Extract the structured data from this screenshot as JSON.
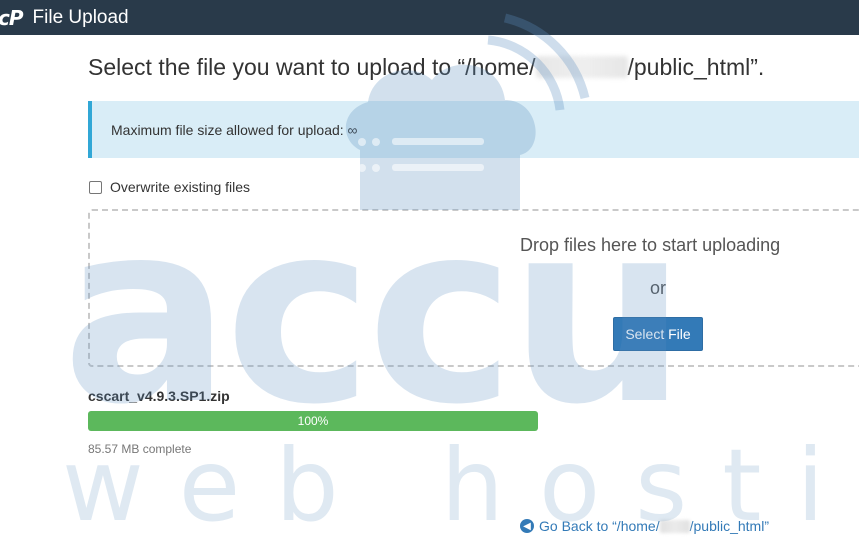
{
  "topbar": {
    "logo": "cP",
    "title": "File Upload"
  },
  "heading": {
    "prefix": "Select the file you want to upload to “/home/",
    "suffix": "/public_html”."
  },
  "info": {
    "max_size_text": "Maximum file size allowed for upload: ∞"
  },
  "options": {
    "overwrite_label": "Overwrite existing files",
    "overwrite_checked": false
  },
  "dropzone": {
    "prompt": "Drop files here to start uploading",
    "or": "or",
    "select_button": "Select File"
  },
  "upload": {
    "filename": "cscart_v4.9.3.SP1.zip",
    "progress_label": "100%",
    "progress": 1.0,
    "status": "85.57 MB complete",
    "bar_color": "#5cb85c"
  },
  "footer": {
    "back_prefix": "Go Back to “/home/",
    "back_suffix": "/public_html”",
    "back_icon": "arrow-left-circle-icon"
  },
  "watermark": {
    "line1": "accu",
    "line2": "web hosting"
  }
}
